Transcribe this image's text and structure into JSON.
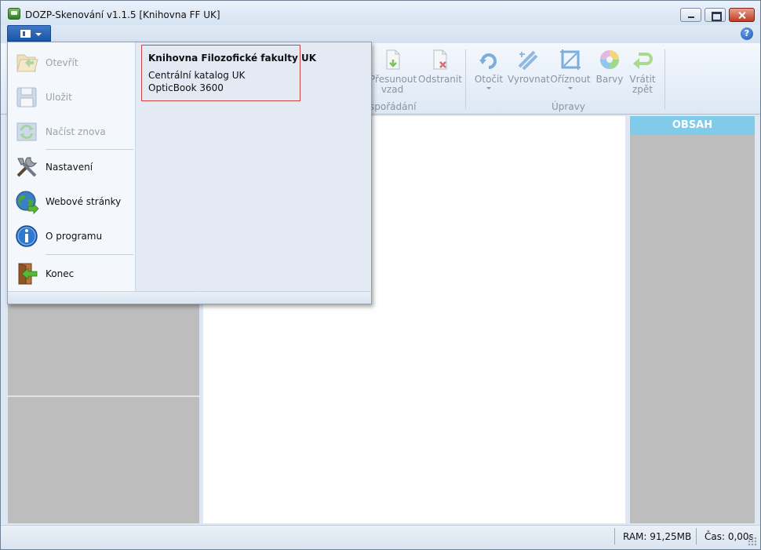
{
  "window": {
    "title": "DOZP-Skenování v1.1.5 [Knihovna FF UK]"
  },
  "ribbon": {
    "buttons": [
      {
        "label": "Přesunout",
        "label2": "vzad",
        "icon": "move-back-icon"
      },
      {
        "label": "Odstranit",
        "label2": "",
        "icon": "delete-page-icon"
      },
      {
        "label": "Otočit",
        "label2": "",
        "icon": "rotate-icon"
      },
      {
        "label": "Vyrovnat",
        "label2": "",
        "icon": "straighten-icon"
      },
      {
        "label": "Oříznout",
        "label2": "",
        "icon": "crop-icon"
      },
      {
        "label": "Barvy",
        "label2": "",
        "icon": "color-wheel-icon"
      },
      {
        "label": "Vrátit",
        "label2": "zpět",
        "icon": "undo-icon"
      }
    ],
    "groups": [
      {
        "label": "spořádání"
      },
      {
        "label": "Úpravy"
      }
    ]
  },
  "app_menu": {
    "items": [
      {
        "label": "Otevřít",
        "icon": "open-folder-icon",
        "enabled": false
      },
      {
        "label": "Uložit",
        "icon": "save-disk-icon",
        "enabled": false
      },
      {
        "label": "Načíst znova",
        "icon": "reload-icon",
        "enabled": false
      },
      {
        "label": "Nastavení",
        "icon": "tools-icon",
        "enabled": true
      },
      {
        "label": "Webové stránky",
        "icon": "globe-icon",
        "enabled": true
      },
      {
        "label": "O programu",
        "icon": "info-icon",
        "enabled": true
      },
      {
        "label": "Konec",
        "icon": "exit-door-icon",
        "enabled": true
      }
    ],
    "info": {
      "title": "Knihovna Filozofické fakulty UK",
      "line1": "Centrální katalog UK",
      "line2": "OpticBook 3600"
    }
  },
  "content_panel": {
    "header": "OBSAH"
  },
  "statusbar": {
    "ram": "RAM: 91,25MB",
    "time": "Čas: 0,00s"
  },
  "colors": {
    "obsah_header": "#7fcbe9",
    "app_button": "#1b55a6",
    "info_border": "#d14343"
  }
}
